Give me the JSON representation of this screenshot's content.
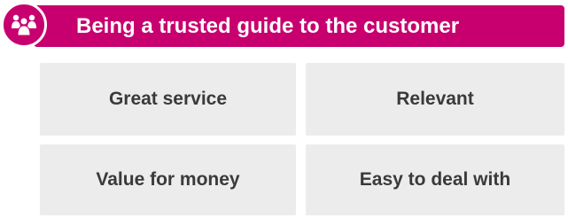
{
  "header": {
    "title": "Being a trusted guide to the customer",
    "icon": "group-of-people-icon",
    "accent_color": "#c8006f"
  },
  "cards": [
    {
      "label": "Great service"
    },
    {
      "label": "Relevant"
    },
    {
      "label": "Value for money"
    },
    {
      "label": "Easy to deal with"
    }
  ],
  "colors": {
    "card_background": "#ececec",
    "card_text": "#3a3a3a",
    "header_text": "#ffffff"
  }
}
